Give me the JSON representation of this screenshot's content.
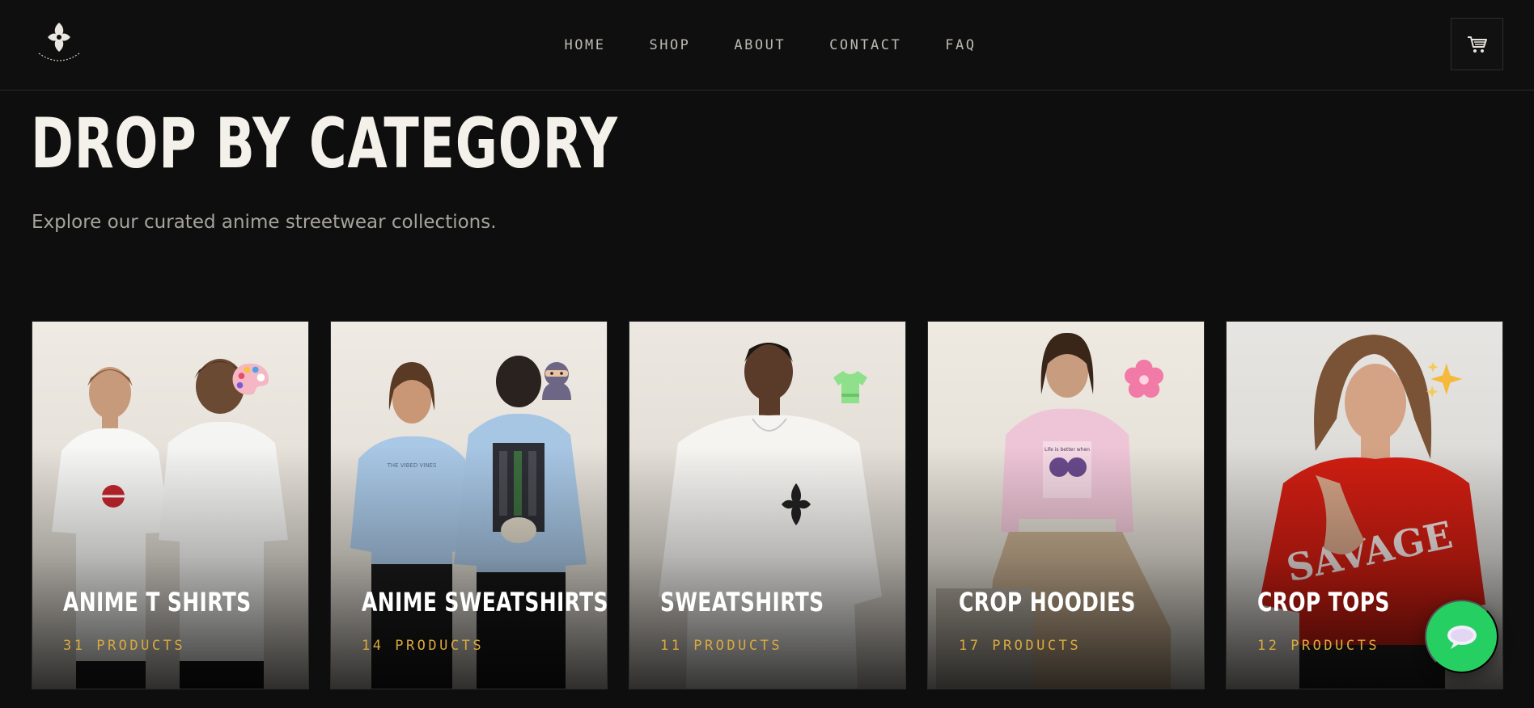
{
  "brand": {
    "logo_icon": "brand-logo-icon"
  },
  "nav": {
    "links": [
      {
        "label": "HOME"
      },
      {
        "label": "SHOP"
      },
      {
        "label": "ABOUT"
      },
      {
        "label": "CONTACT"
      },
      {
        "label": "FAQ"
      }
    ],
    "cart_icon": "cart-icon"
  },
  "section": {
    "title": "DROP BY CATEGORY",
    "subtitle": "Explore our curated anime streetwear collections."
  },
  "categories": [
    {
      "title": "ANIME T SHIRTS",
      "count": "31 PRODUCTS",
      "badge_icon": "palette-icon",
      "accent": "#f2a7b8"
    },
    {
      "title": "ANIME SWEATSHIRTS",
      "count": "14 PRODUCTS",
      "badge_icon": "ninja-icon",
      "accent": "#6a5a8c"
    },
    {
      "title": "SWEATSHIRTS",
      "count": "11 PRODUCTS",
      "badge_icon": "tshirt-icon",
      "accent": "#8fe08a"
    },
    {
      "title": "CROP HOODIES",
      "count": "17 PRODUCTS",
      "badge_icon": "cherry-blossom-icon",
      "accent": "#f27aa6"
    },
    {
      "title": "CROP TOPS",
      "count": "12 PRODUCTS",
      "badge_icon": "sparkles-icon",
      "accent": "#f6b93b"
    }
  ],
  "chat": {
    "icon": "chat-bubble-icon",
    "color": "#26cf62"
  },
  "colors": {
    "background": "#0e0e0e",
    "accent_gold": "#d9a93d",
    "nav_text": "#bdbab3"
  }
}
